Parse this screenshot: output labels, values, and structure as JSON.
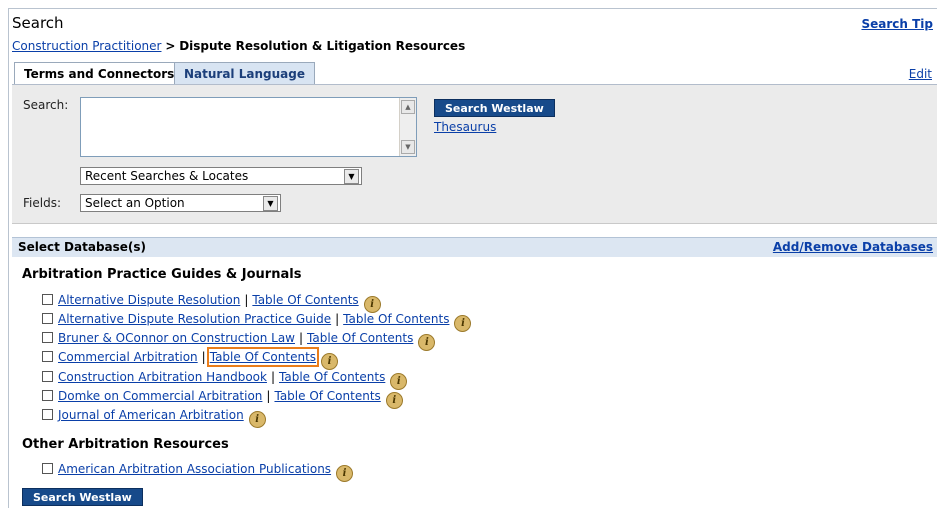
{
  "header": {
    "title": "Search",
    "search_tips": "Search Tip"
  },
  "breadcrumb": {
    "parent": "Construction Practitioner",
    "separator": ">",
    "current": "Dispute Resolution & Litigation Resources"
  },
  "tabs": [
    {
      "label": "Terms and Connectors",
      "active": true
    },
    {
      "label": "Natural Language",
      "active": false
    }
  ],
  "edit_label": "Edit",
  "search_form": {
    "search_label": "Search:",
    "search_value": "",
    "search_button": "Search Westlaw",
    "thesaurus_link": "Thesaurus",
    "recent_select": "Recent Searches & Locates",
    "fields_label": "Fields:",
    "fields_select": "Select an Option"
  },
  "databases": {
    "title": "Select Database(s)",
    "add_remove": "Add/Remove Databases",
    "toc_label": "Table Of Contents",
    "groups": [
      {
        "heading": "Arbitration Practice Guides & Journals",
        "items": [
          {
            "name": "Alternative Dispute Resolution",
            "toc": true
          },
          {
            "name": "Alternative Dispute Resolution Practice Guide",
            "toc": true
          },
          {
            "name": "Bruner & OConnor on Construction Law",
            "toc": true
          },
          {
            "name": "Commercial Arbitration",
            "toc": true,
            "highlighted": true
          },
          {
            "name": "Construction Arbitration Handbook",
            "toc": true
          },
          {
            "name": "Domke on Commercial Arbitration",
            "toc": true
          },
          {
            "name": "Journal of American Arbitration",
            "toc": false
          }
        ]
      },
      {
        "heading": "Other Arbitration Resources",
        "items": [
          {
            "name": "American Arbitration Association Publications",
            "toc": false
          }
        ]
      }
    ]
  },
  "bottom_button": "Search Westlaw",
  "colors": {
    "link": "#0a3fa8",
    "button": "#174a8a",
    "highlight": "#ea7d1a",
    "db_bar": "#dce6f2",
    "panel": "#ebebeb"
  }
}
